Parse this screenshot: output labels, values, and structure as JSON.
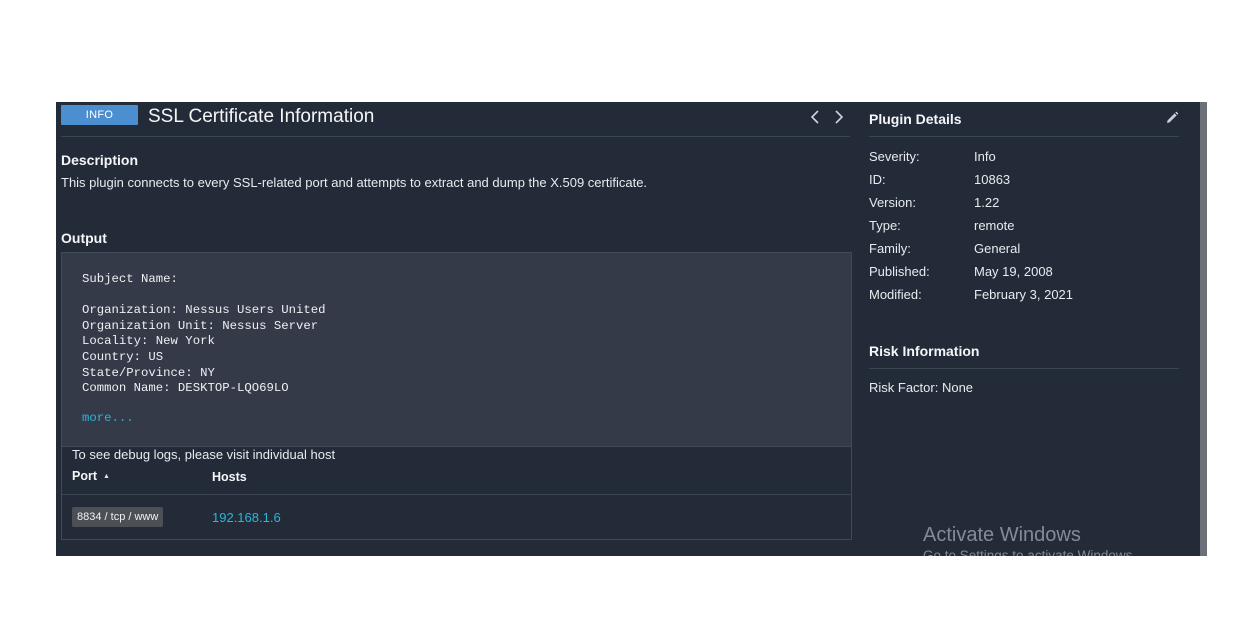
{
  "plugin": {
    "severity_badge": "INFO",
    "title": "SSL Certificate Information"
  },
  "description": {
    "heading": "Description",
    "text": "This plugin connects to every SSL-related port and attempts to extract and dump the X.509 certificate."
  },
  "output": {
    "heading": "Output",
    "text": "Subject Name:\n\nOrganization: Nessus Users United\nOrganization Unit: Nessus Server\nLocality: New York\nCountry: US\nState/Province: NY\nCommon Name: DESKTOP-LQO69LO",
    "more_label": "more...",
    "debug_note": "To see debug logs, please visit individual host",
    "columns": {
      "port": "Port",
      "hosts": "Hosts"
    },
    "rows": [
      {
        "port": "8834 / tcp / www",
        "host": "192.168.1.6"
      }
    ]
  },
  "plugin_details": {
    "heading": "Plugin Details",
    "items": [
      {
        "label": "Severity:",
        "value": "Info"
      },
      {
        "label": "ID:",
        "value": "10863"
      },
      {
        "label": "Version:",
        "value": "1.22"
      },
      {
        "label": "Type:",
        "value": "remote"
      },
      {
        "label": "Family:",
        "value": "General"
      },
      {
        "label": "Published:",
        "value": "May 19, 2008"
      },
      {
        "label": "Modified:",
        "value": "February 3, 2021"
      }
    ]
  },
  "risk_information": {
    "heading": "Risk Information",
    "risk_factor": "Risk Factor: None"
  },
  "watermark": {
    "title": "Activate Windows",
    "subtitle": "Go to Settings to activate Windows."
  },
  "icons": {
    "prev": "chevron-left-icon",
    "next": "chevron-right-icon",
    "edit": "pencil-icon",
    "sort": "sort-ascending-icon"
  },
  "colors": {
    "panel_bg": "#232b38",
    "output_bg": "#343a48",
    "info_badge": "#4b8fd0",
    "link": "#2bb6d8"
  }
}
